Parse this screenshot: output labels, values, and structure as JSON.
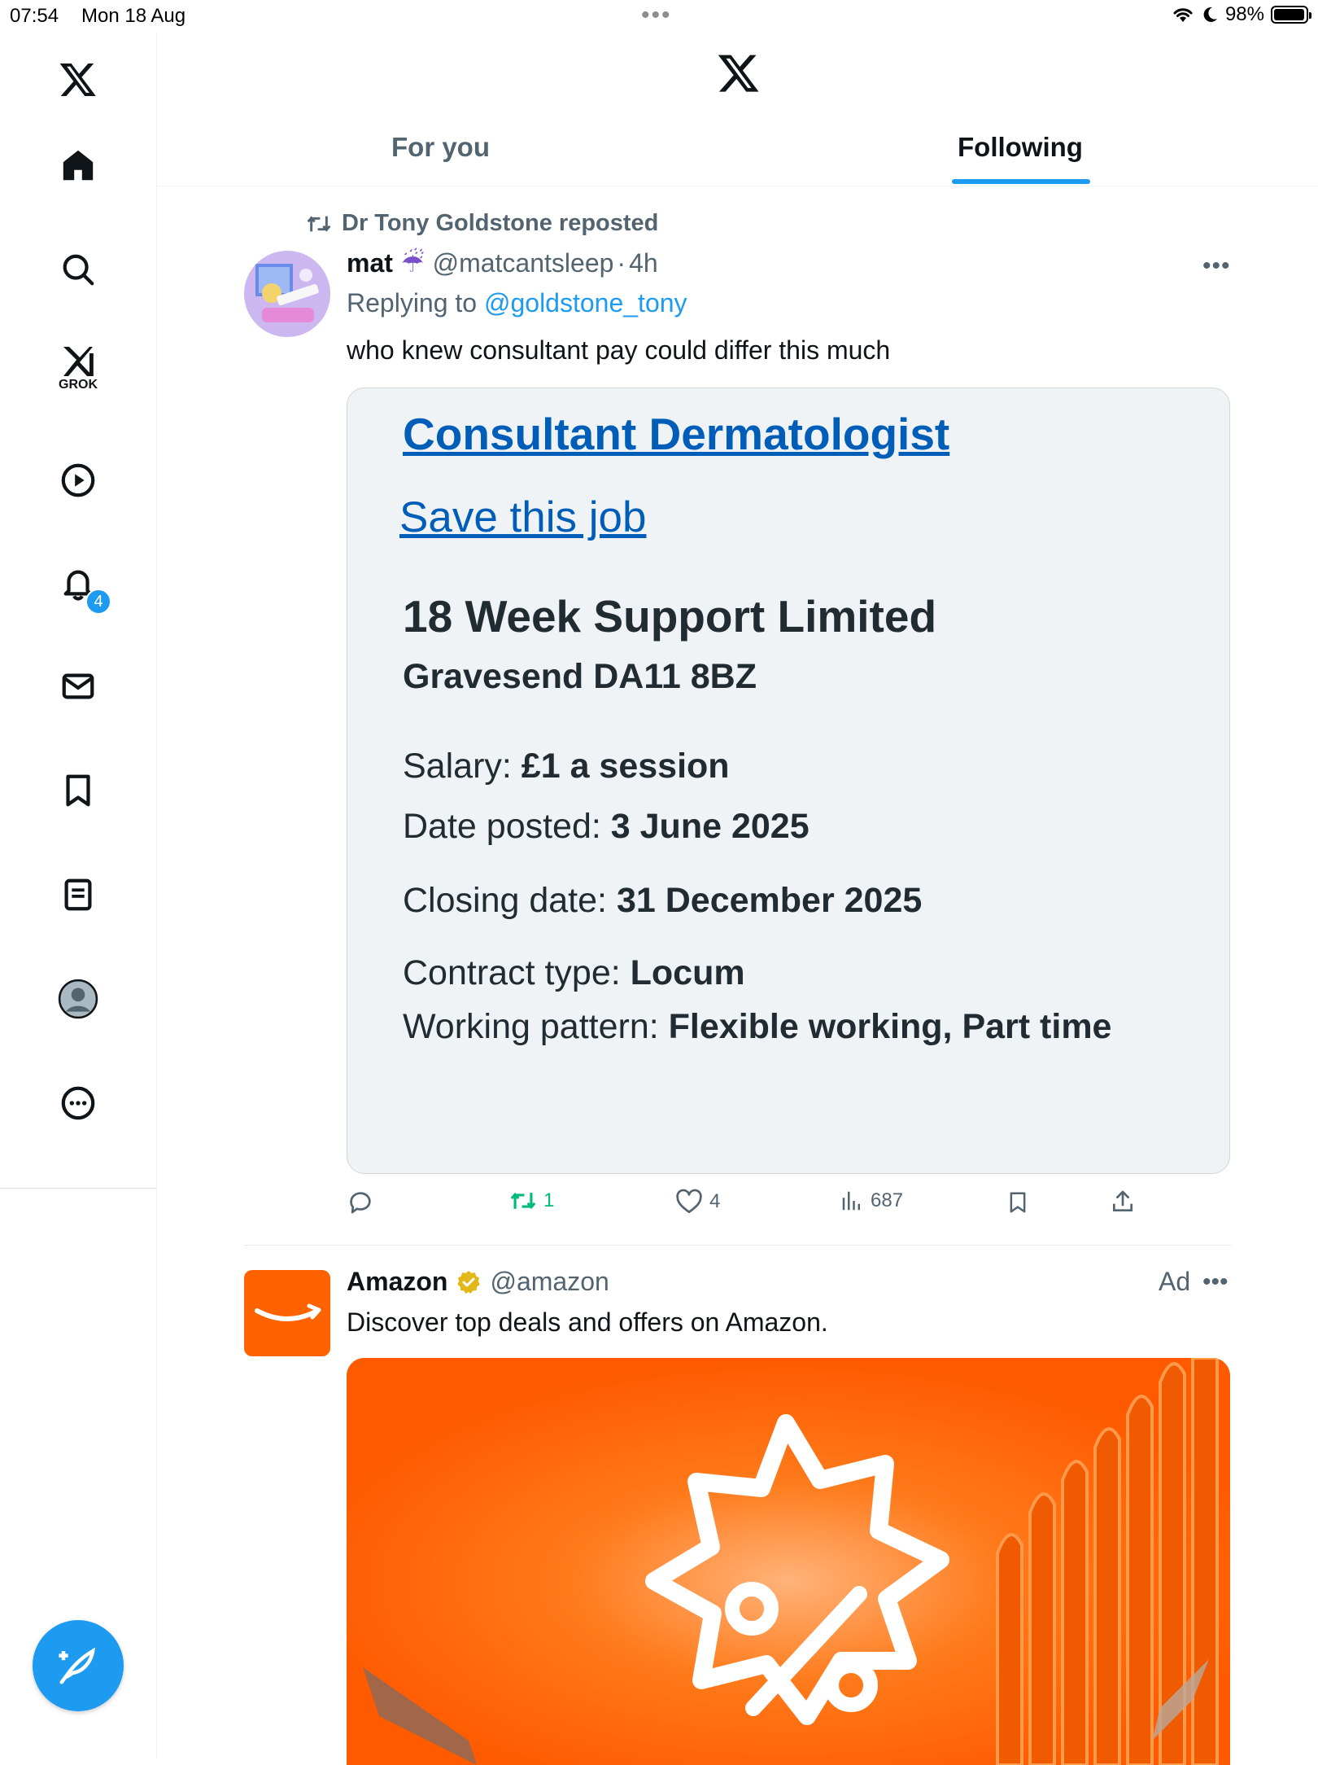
{
  "status_bar": {
    "time": "07:54",
    "date": "Mon 18 Aug",
    "battery": "98%",
    "battery_level": 0.98
  },
  "sidebar": {
    "grok_label": "GROK",
    "notifications_badge": "4",
    "items": [
      "home-icon",
      "search-icon",
      "grok-icon",
      "video-icon",
      "bell-icon",
      "mail-icon",
      "bookmark-icon",
      "lists-icon",
      "profile-icon",
      "more-icon"
    ]
  },
  "tabs": {
    "for_you": "For you",
    "following": "Following",
    "active": "following"
  },
  "post": {
    "repost_label": "Dr Tony Goldstone reposted",
    "author_name": "mat",
    "author_emoji": "☔",
    "handle": "@matcantsleep",
    "separator": "·",
    "time": "4h",
    "replying_prefix": "Replying to",
    "replying_handle": "@goldstone_tony",
    "text": "who knew consultant pay could differ this much",
    "card": {
      "job_title": "Consultant Dermatologist",
      "save_link": "Save this job",
      "employer": "18 Week Support Limited",
      "location": "Gravesend DA11 8BZ",
      "salary_label": "Salary:",
      "salary_value": "£1 a session",
      "date_posted_label": "Date posted:",
      "date_posted_value": "3 June 2025",
      "closing_label": "Closing date:",
      "closing_value": "31 December 2025",
      "contract_label": "Contract type:",
      "contract_value": "Locum",
      "pattern_label": "Working pattern:",
      "pattern_value": "Flexible working, Part time"
    },
    "stats": {
      "reposts": "1",
      "likes": "4",
      "views": "687"
    }
  },
  "ad": {
    "name": "Amazon",
    "handle": "@amazon",
    "label": "Ad",
    "text": "Discover top deals and offers on Amazon.",
    "brand_color": "#ff6200"
  },
  "colors": {
    "accent": "#1d9bf0",
    "repost_green": "#00ba7c",
    "nhs_blue": "#005eb8",
    "muted": "#536471"
  }
}
